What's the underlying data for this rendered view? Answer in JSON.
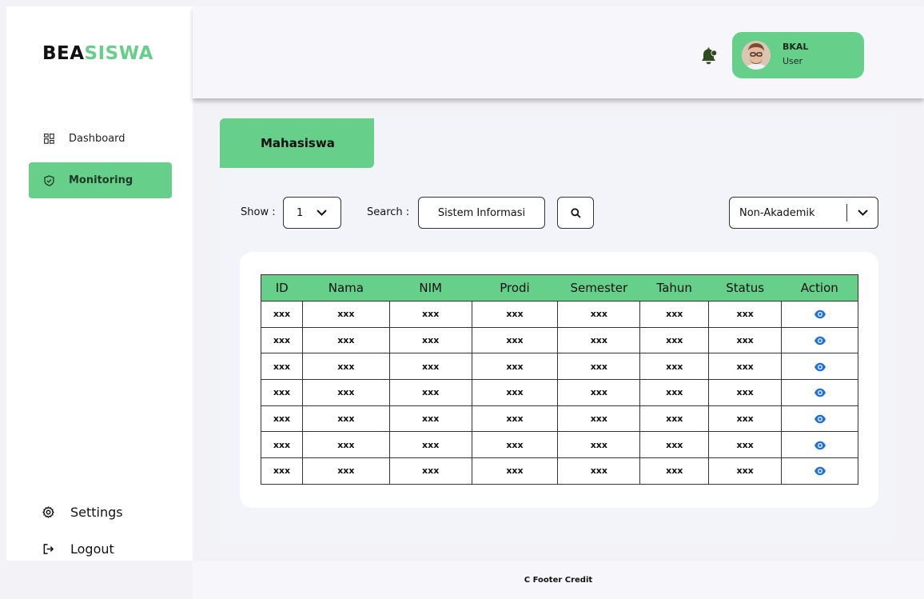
{
  "brand": {
    "part1": "BEA",
    "part2": "SISWA",
    "accent": "#66cf8a"
  },
  "sidebar": {
    "items": [
      {
        "label": "Dashboard",
        "icon": "grid-icon",
        "active": false
      },
      {
        "label": "Monitoring",
        "icon": "shield-check-icon",
        "active": true
      }
    ],
    "settings_label": "Settings",
    "logout_label": "Logout"
  },
  "header": {
    "user_name": "BKAL",
    "user_role": "User",
    "notification_icon": "bell-icon"
  },
  "main": {
    "tab_label": "Mahasiswa",
    "show_label": "Show :",
    "show_value": "1",
    "search_label": "Search :",
    "search_value": "Sistem Informasi",
    "filter_value": "Non-Akademik"
  },
  "table": {
    "columns": [
      "ID",
      "Nama",
      "NIM",
      "Prodi",
      "Semester",
      "Tahun",
      "Status",
      "Action"
    ],
    "rows": [
      [
        "xxx",
        "xxx",
        "xxx",
        "xxx",
        "xxx",
        "xxx",
        "xxx"
      ],
      [
        "xxx",
        "xxx",
        "xxx",
        "xxx",
        "xxx",
        "xxx",
        "xxx"
      ],
      [
        "xxx",
        "xxx",
        "xxx",
        "xxx",
        "xxx",
        "xxx",
        "xxx"
      ],
      [
        "xxx",
        "xxx",
        "xxx",
        "xxx",
        "xxx",
        "xxx",
        "xxx"
      ],
      [
        "xxx",
        "xxx",
        "xxx",
        "xxx",
        "xxx",
        "xxx",
        "xxx"
      ],
      [
        "xxx",
        "xxx",
        "xxx",
        "xxx",
        "xxx",
        "xxx",
        "xxx"
      ],
      [
        "xxx",
        "xxx",
        "xxx",
        "xxx",
        "xxx",
        "xxx",
        "xxx"
      ]
    ],
    "action_icon": "eye-icon",
    "action_color": "#1e6fe0"
  },
  "footer": {
    "text": "C Footer Credit"
  }
}
